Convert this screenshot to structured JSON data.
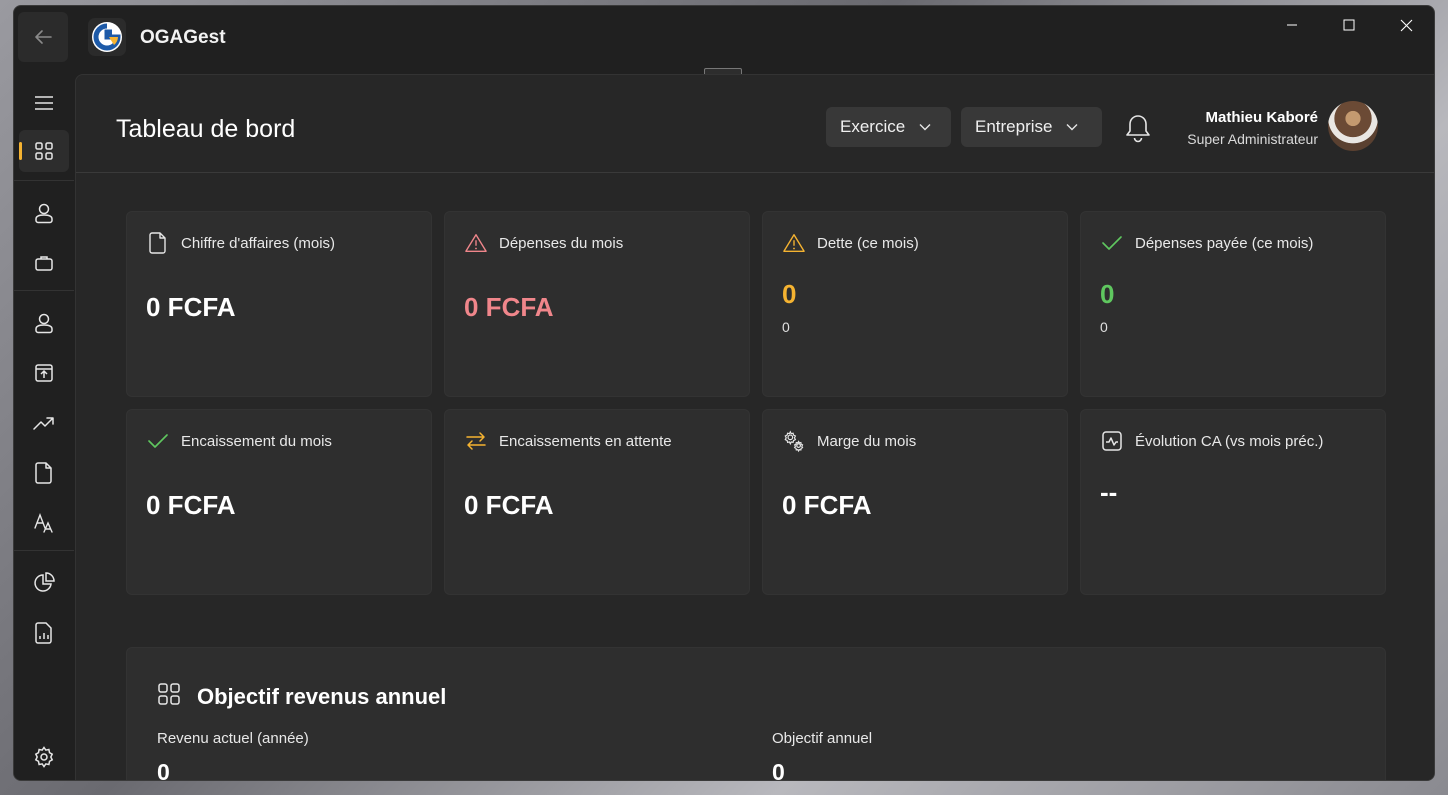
{
  "window": {
    "app_title": "OGAGest",
    "controls": {
      "minimize": "minimize-icon",
      "maximize": "maximize-icon",
      "close": "close-icon"
    }
  },
  "sidebar": {
    "items": [
      {
        "icon": "menu-icon"
      },
      {
        "icon": "dashboard-grid-icon",
        "active": true
      },
      {
        "icon": "user-icon"
      },
      {
        "icon": "briefcase-icon"
      },
      {
        "icon": "user-icon"
      },
      {
        "icon": "upload-box-icon"
      },
      {
        "icon": "trending-up-icon"
      },
      {
        "icon": "document-icon"
      },
      {
        "icon": "font-size-icon"
      },
      {
        "icon": "pie-chart-icon"
      },
      {
        "icon": "report-icon"
      },
      {
        "icon": "settings-gear-icon"
      }
    ]
  },
  "header": {
    "title": "Tableau de bord",
    "exercice_label": "Exercice",
    "entreprise_label": "Entreprise",
    "user_name": "Mathieu Kaboré",
    "user_role": "Super Administrateur"
  },
  "cards": [
    {
      "label": "Chiffre d'affaires (mois)",
      "value": "0 FCFA",
      "icon": "document-icon",
      "value_color": "#ffffff"
    },
    {
      "label": "Dépenses du mois",
      "value": "0 FCFA",
      "icon": "warning-icon",
      "value_color": "#f0868b"
    },
    {
      "label": "Dette (ce mois)",
      "value": "0",
      "sub": "0",
      "icon": "warning-icon",
      "value_color": "#f5b331"
    },
    {
      "label": "Dépenses payée (ce mois)",
      "value": "0",
      "sub": "0",
      "icon": "check-icon",
      "value_color": "#5fc75f"
    },
    {
      "label": "Encaissement du mois",
      "value": "0 FCFA",
      "icon": "check-icon",
      "value_color": "#ffffff"
    },
    {
      "label": "Encaissements en attente",
      "value": "0 FCFA",
      "icon": "swap-arrows-icon",
      "value_color": "#ffffff"
    },
    {
      "label": "Marge du mois",
      "value": "0 FCFA",
      "icon": "gears-icon",
      "value_color": "#ffffff"
    },
    {
      "label": "Évolution CA (vs mois préc.)",
      "value": "--",
      "icon": "activity-icon",
      "value_color": "#ffffff"
    }
  ],
  "objective": {
    "title": "Objectif revenus annuel",
    "current_label": "Revenu actuel (année)",
    "current_value": "0",
    "target_label": "Objectif annuel",
    "target_value": "0"
  },
  "colors": {
    "accent": "#f5b331",
    "danger": "#f0868b",
    "success": "#5fc75f"
  }
}
